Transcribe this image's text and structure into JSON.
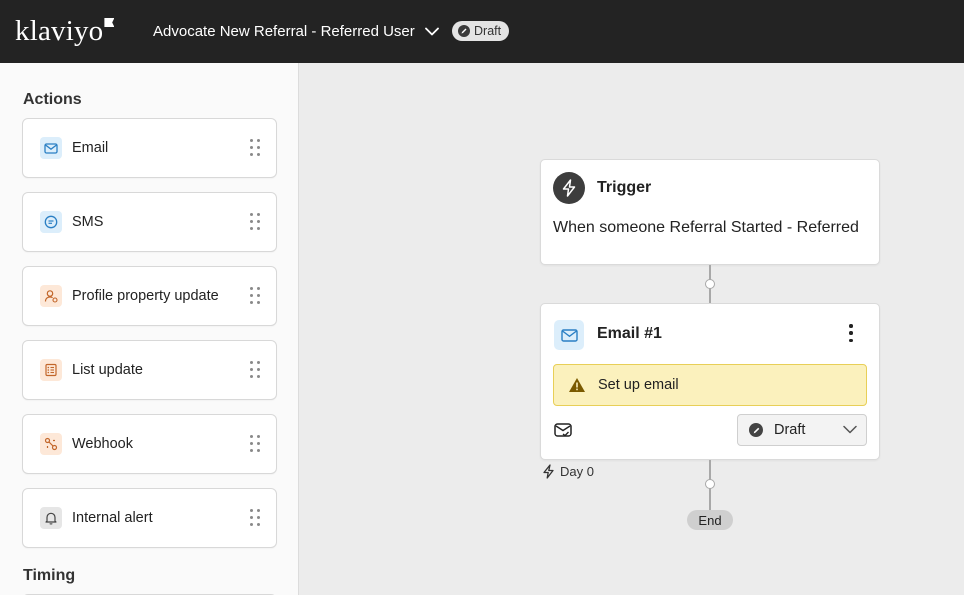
{
  "header": {
    "logo_text": "klaviyo",
    "flow_title": "Advocate New Referral - Referred User",
    "status_badge": "Draft",
    "background_color": "#232323"
  },
  "sidebar": {
    "actions_title": "Actions",
    "timing_title": "Timing",
    "actions": [
      {
        "label": "Email",
        "icon": "email-icon",
        "color": "#dceefb"
      },
      {
        "label": "SMS",
        "icon": "sms-icon",
        "color": "#dceefb"
      },
      {
        "label": "Profile property update",
        "icon": "profile-icon",
        "color": "#fde8d8"
      },
      {
        "label": "List update",
        "icon": "list-icon",
        "color": "#fde8d8"
      },
      {
        "label": "Webhook",
        "icon": "webhook-icon",
        "color": "#fde8d8"
      },
      {
        "label": "Internal alert",
        "icon": "bell-icon",
        "color": "#e6e6e6"
      }
    ]
  },
  "canvas": {
    "trigger": {
      "title": "Trigger",
      "description": "When someone Referral Started - Referred"
    },
    "email_node": {
      "title": "Email #1",
      "warning": "Set up email",
      "status": "Draft",
      "warning_color": "#fbf1bd"
    },
    "delay_label": "Day 0",
    "end_label": "End"
  }
}
